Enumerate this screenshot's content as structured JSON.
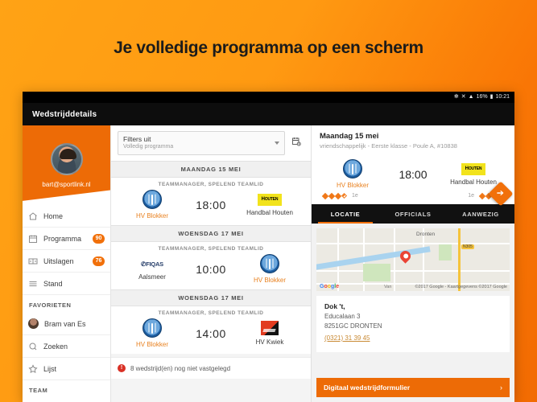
{
  "promo": {
    "headline": "Je volledige programma op een scherm"
  },
  "statusbar": {
    "bluetooth_icon": "bluetooth-icon",
    "mute_icon": "mute-icon",
    "wifi_icon": "wifi-icon",
    "battery_percent": "16%",
    "battery_icon": "battery-icon",
    "time": "10:21"
  },
  "appbar": {
    "title": "Wedstrijddetails"
  },
  "sidebar": {
    "account_email": "bart@sportlink.nl",
    "avatar_name": "avatar",
    "items": [
      {
        "label": "Home",
        "icon": "home-icon",
        "badge": ""
      },
      {
        "label": "Programma",
        "icon": "calendar-icon",
        "badge": "90"
      },
      {
        "label": "Uitslagen",
        "icon": "scoreboard-icon",
        "badge": "76"
      },
      {
        "label": "Stand",
        "icon": "list-icon",
        "badge": ""
      }
    ],
    "favorites_label": "FAVORIETEN",
    "favorites": [
      {
        "label": "Bram van Es",
        "icon": "person-avatar"
      },
      {
        "label": "Zoeken",
        "icon": "search-icon"
      },
      {
        "label": "Lijst",
        "icon": "star-icon"
      }
    ],
    "team_label": "TEAM"
  },
  "list": {
    "filter": {
      "value": "Filters uit",
      "subvalue": "Volledig programma",
      "caret_icon": "chevron-down-icon"
    },
    "calendar_button_icon": "calendar-clock-icon",
    "groups": [
      {
        "day": "MAANDAG 15 MEI",
        "matches": [
          {
            "role": "TEAMMANAGER, SPELEND TEAMLID",
            "time": "18:00",
            "home": {
              "name": "HV Blokker",
              "logo": "hv-blokker-logo",
              "highlight": true
            },
            "away": {
              "name": "Handbal Houten",
              "logo": "handbal-houten-logo",
              "highlight": false
            }
          }
        ]
      },
      {
        "day": "WOENSDAG 17 MEI",
        "matches": [
          {
            "role": "TEAMMANAGER, SPELEND TEAMLID",
            "time": "10:00",
            "home": {
              "name": "Aalsmeer",
              "logo": "fiqas-aalsmeer-logo",
              "highlight": false
            },
            "away": {
              "name": "HV Blokker",
              "logo": "hv-blokker-logo",
              "highlight": true
            }
          }
        ]
      },
      {
        "day": "WOENSDAG 17 MEI",
        "matches": [
          {
            "role": "TEAMMANAGER, SPELEND TEAMLID",
            "time": "14:00",
            "home": {
              "name": "HV Blokker",
              "logo": "hv-blokker-logo",
              "highlight": true
            },
            "away": {
              "name": "HV Kwiek",
              "logo": "hv-kwiek-logo",
              "highlight": false
            }
          }
        ]
      }
    ],
    "warning": {
      "icon": "warning-icon",
      "icon_glyph": "!",
      "text": "8 wedstrijd(en) nog niet vastgelegd"
    }
  },
  "detail": {
    "title": "Maandag 15 mei",
    "subtitle": "vriendschappelijk - Eerste klasse - Poule A, #10838",
    "time": "18:00",
    "home": {
      "name": "HV Blokker",
      "logo": "hv-blokker-logo",
      "rank": "1e"
    },
    "away": {
      "name": "Handbal Houten",
      "logo": "handbal-houten-logo",
      "rank": "1e"
    },
    "tabs": [
      {
        "label": "LOCATIE",
        "active": true
      },
      {
        "label": "OFFICIALS",
        "active": false
      },
      {
        "label": "AANWEZIG",
        "active": false
      }
    ],
    "map": {
      "city_label": "Dronten",
      "road_shield": "N305",
      "brand": "Google",
      "attribution": "©2017 Google - Kaartgegevens ©2017 Google",
      "small_label": "Van",
      "marker_icon": "map-marker-icon"
    },
    "directions_fab_icon": "directions-arrow-icon",
    "address": {
      "venue": "Dok 't,",
      "street": "Educalaan 3",
      "city": "8251GC DRONTEN",
      "phone": "(0321) 31 39 45"
    },
    "cta": {
      "label": "Digitaal wedstrijdformulier",
      "arrow_icon": "chevron-right-icon"
    }
  },
  "colors": {
    "brand_orange": "#ED6B06",
    "accent_orange": "#F1700A",
    "warning_red": "#D93025",
    "houten_yellow": "#F2E31C"
  }
}
